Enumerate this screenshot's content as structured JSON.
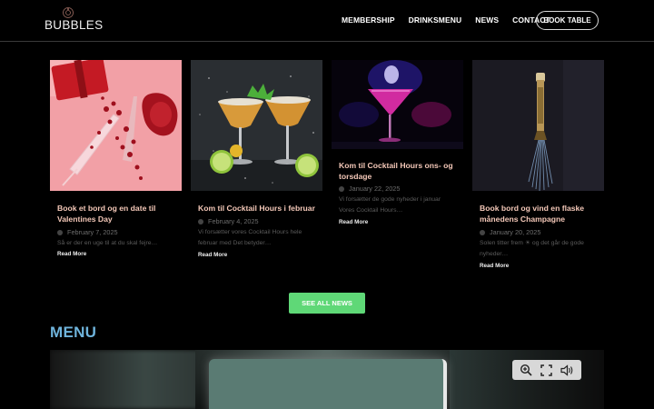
{
  "header": {
    "logo_text": "BUBBLES",
    "nav": [
      "MEMBERSHIP",
      "DRINKSMENU",
      "NEWS",
      "CONTACT"
    ],
    "book_button": "BOOK TABLE"
  },
  "news": [
    {
      "title": "Book et bord og en date til Valentines Day",
      "date": "February 7, 2025",
      "excerpt": "Så er der en uge til at du skal fejre…",
      "read_more": "Read More",
      "image_icon": "valentine-champagne-image"
    },
    {
      "title": "Kom til Cocktail Hours i februar",
      "date": "February 4, 2025",
      "excerpt": "Vi forsætter vores Cocktail Hours hele februar med Det betyder…",
      "read_more": "Read More",
      "image_icon": "margarita-cocktails-image"
    },
    {
      "title": "Kom til Cocktail Hours ons- og torsdage",
      "date": "January 22, 2025",
      "excerpt": "Vi forsætter de gode nyheder i januar Vores Cocktail Hours…",
      "read_more": "Read More",
      "image_icon": "pink-cocktail-image"
    },
    {
      "title": "Book bord og vind en flaske månedens Champagne",
      "date": "January 20, 2025",
      "excerpt": "Solen titter frem ☀ og det går de gode nyheder…",
      "read_more": "Read More",
      "image_icon": "champagne-bottle-image"
    }
  ],
  "see_all_button": "SEE ALL NEWS",
  "menu_heading": "MENU",
  "viewer_toolbar": [
    "zoom-in-icon",
    "fullscreen-icon",
    "sound-icon"
  ],
  "colors": {
    "background": "#000000",
    "card_title": "#f4c8b8",
    "see_all_green": "#5fd877",
    "menu_heading": "#6fb4dc"
  }
}
